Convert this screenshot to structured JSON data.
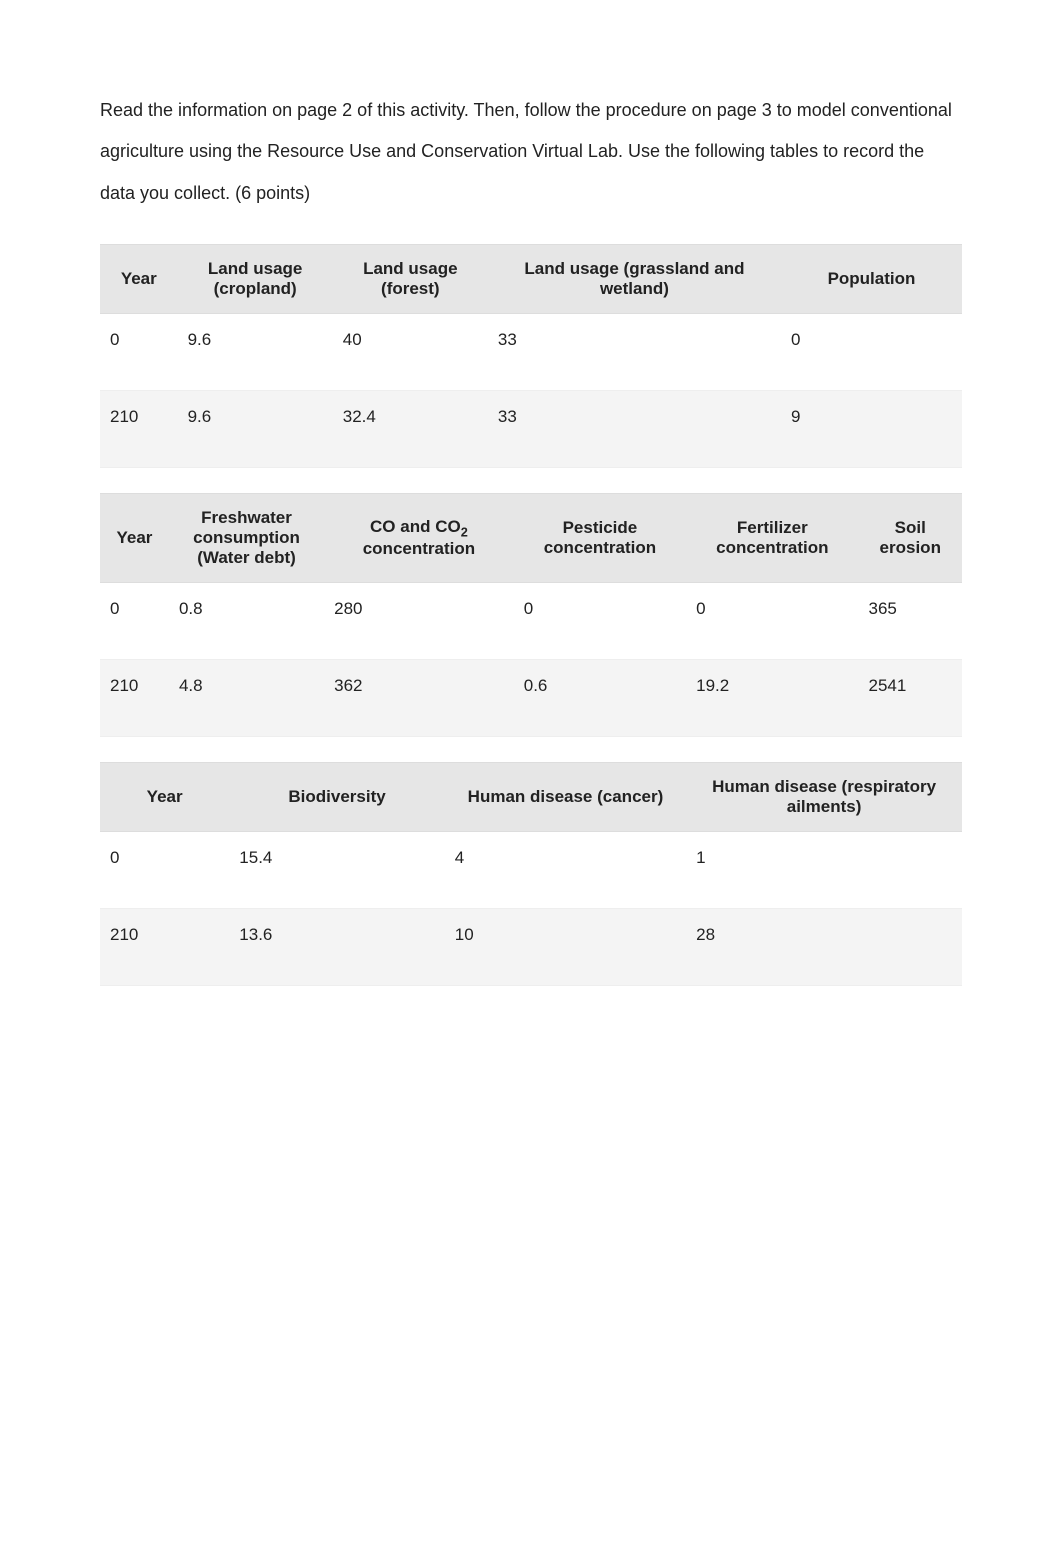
{
  "intro": "Read the information on page 2 of this activity. Then, follow the procedure on page 3 to model conventional agriculture using the Resource Use and Conservation Virtual Lab. Use the following tables to record the data you collect. (6 points)",
  "table1": {
    "headers": {
      "year": "Year",
      "cropland": "Land usage (cropland)",
      "forest": "Land usage (forest)",
      "grassland": "Land usage (grassland and wetland)",
      "population": "Population"
    },
    "rows": [
      {
        "year": "0",
        "cropland": "9.6",
        "forest": "40",
        "grassland": "33",
        "population": "0"
      },
      {
        "year": "210",
        "cropland": "9.6",
        "forest": "32.4",
        "grassland": "33",
        "population": "9"
      }
    ]
  },
  "table2": {
    "headers": {
      "year": "Year",
      "freshwater": "Freshwater consumption (Water debt)",
      "co2_pre": "CO and CO",
      "co2_sub": "2",
      "co2_post": " concentration",
      "pesticide": "Pesticide concentration",
      "fertilizer": "Fertilizer concentration",
      "soil": "Soil erosion"
    },
    "rows": [
      {
        "year": "0",
        "freshwater": "0.8",
        "co2": "280",
        "pesticide": "0",
        "fertilizer": "0",
        "soil": "365"
      },
      {
        "year": "210",
        "freshwater": "4.8",
        "co2": "362",
        "pesticide": "0.6",
        "fertilizer": "19.2",
        "soil": "2541"
      }
    ]
  },
  "table3": {
    "headers": {
      "year": "Year",
      "biodiversity": "Biodiversity",
      "cancer": "Human disease (cancer)",
      "respiratory": "Human disease (respiratory ailments)"
    },
    "rows": [
      {
        "year": "0",
        "biodiversity": "15.4",
        "cancer": "4",
        "respiratory": "1"
      },
      {
        "year": "210",
        "biodiversity": "13.6",
        "cancer": "10",
        "respiratory": "28"
      }
    ]
  }
}
